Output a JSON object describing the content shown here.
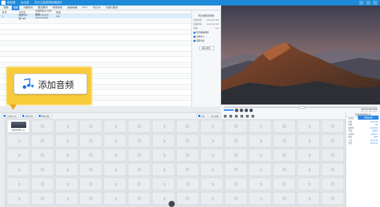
{
  "window": {
    "app_name": "爱剪辑",
    "title_parts": [
      "未注册",
      "官方正版视频剪辑软件"
    ]
  },
  "menu": {
    "items": [
      "视频",
      "音频",
      "字幕特效",
      "叠加素材",
      "转场特效",
      "画面风格",
      "MTV",
      "卡拉OK",
      "升级与服务"
    ],
    "active_index": 1
  },
  "audio_table": {
    "headers": [
      "序号",
      "文件名",
      "在最终影片中的时间",
      "音量"
    ],
    "rows": [
      [
        "1",
        "我爱你中国.mp3",
        "00:00:00.000 - 00:03:25.369",
        "100"
      ]
    ]
  },
  "audio_settings": {
    "section_title": "预览/截取原音频",
    "fields": [
      "开始时间",
      "结束时间",
      "音量"
    ],
    "field_values": [
      "00:00:00.000",
      "00:03:25.369",
      "100"
    ],
    "sync_label": "同步播放视频",
    "fade_in": "头部淡入",
    "fade_out": "尾部淡出",
    "confirm_button": "确认修改"
  },
  "preview": {
    "accent_sky_top": "#3b3e4f",
    "accent_sky_glow": "#d49a7a",
    "mountain_dark": "#2d2f35",
    "mountain_warm": "#8a4a2c"
  },
  "player": {
    "current_time": "00:00:00.000",
    "total_time": "00:03:25.369",
    "progress": 0.0
  },
  "callout": {
    "add_audio_label": "添加音频",
    "accent": "#f8cb3a"
  },
  "toolstrip": {
    "left_tab": "已添加片段",
    "buttons": [
      "添加音频",
      "删除音频"
    ],
    "right_buttons": [
      "遮罩",
      "导出视频"
    ]
  },
  "timeline": {
    "first_clip_caption": "我爱你中国.mp3",
    "columns": 14,
    "rows": 6
  },
  "info_panel": {
    "title": "所选音频的信息",
    "effect_button": "特效合成",
    "rows": [
      [
        "文件名",
        "我爱你中国.mp3"
      ],
      [
        "时长",
        "00:03:25"
      ],
      [
        "音量",
        "100"
      ],
      [
        "采样率",
        "44100Hz"
      ],
      [
        "声道",
        "立体声"
      ],
      [
        "比特率",
        "320kbps"
      ],
      [
        "格式",
        "MP3"
      ],
      [
        "入点",
        "00:00:00"
      ],
      [
        "出点",
        "00:03:25"
      ]
    ]
  }
}
